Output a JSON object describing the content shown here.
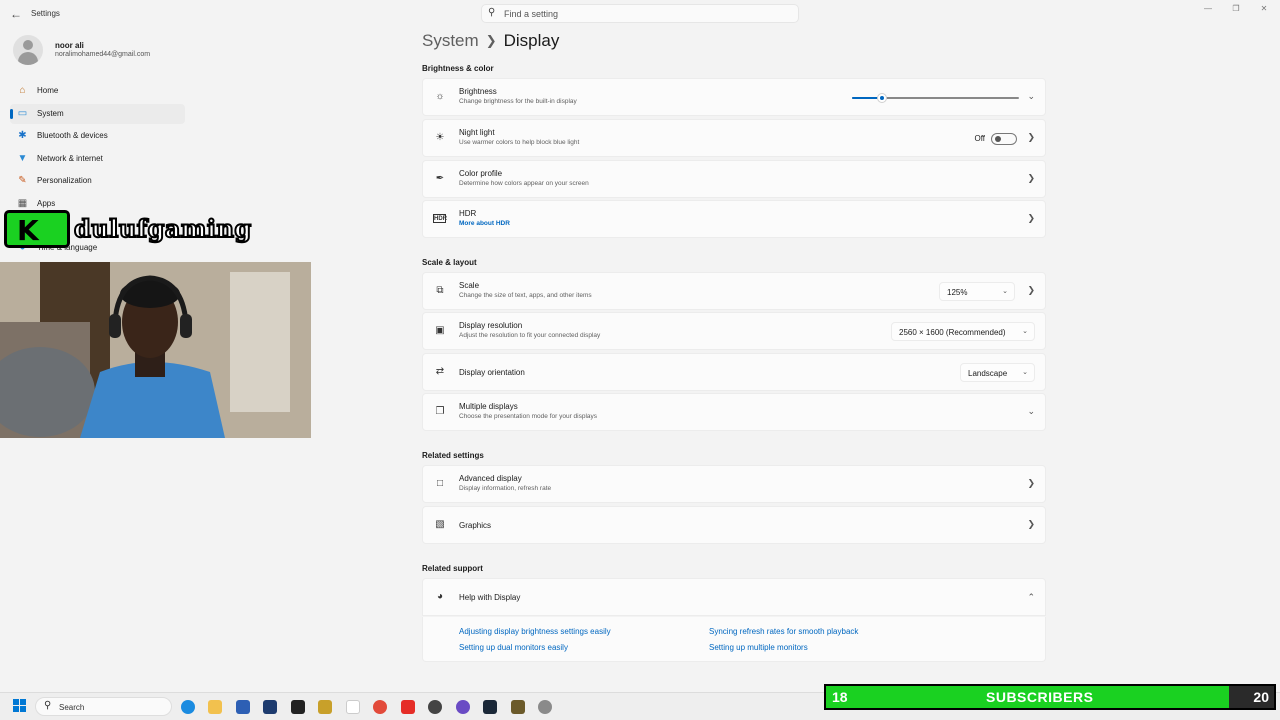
{
  "window": {
    "app_title": "Settings",
    "search_placeholder": "Find a setting"
  },
  "profile": {
    "name": "noor ali",
    "email": "noralimohamed44@gmail.com"
  },
  "sidebar": {
    "items": [
      {
        "label": "Home",
        "icon": "home-icon"
      },
      {
        "label": "System",
        "icon": "monitor-icon",
        "active": true
      },
      {
        "label": "Bluetooth & devices",
        "icon": "bluetooth-icon"
      },
      {
        "label": "Network & internet",
        "icon": "wifi-icon"
      },
      {
        "label": "Personalization",
        "icon": "brush-icon"
      },
      {
        "label": "Apps",
        "icon": "apps-icon"
      },
      {
        "label": "Time & language",
        "icon": "globe-icon"
      }
    ]
  },
  "overlay": {
    "brand": "dulufgaming",
    "logo_letter": "K"
  },
  "breadcrumb": {
    "parent": "System",
    "current": "Display"
  },
  "sections": {
    "brightness_color": "Brightness & color",
    "scale_layout": "Scale & layout",
    "related_settings": "Related settings",
    "related_support": "Related support"
  },
  "brightness": {
    "title": "Brightness",
    "subtitle": "Change brightness for the built-in display",
    "level": 0.18
  },
  "night_light": {
    "title": "Night light",
    "subtitle": "Use warmer colors to help block blue light",
    "state": "Off"
  },
  "color_profile": {
    "title": "Color profile",
    "subtitle": "Determine how colors appear on your screen"
  },
  "hdr": {
    "title": "HDR",
    "link": "More about HDR"
  },
  "scale": {
    "title": "Scale",
    "subtitle": "Change the size of text, apps, and other items",
    "value": "125%"
  },
  "resolution": {
    "title": "Display resolution",
    "subtitle": "Adjust the resolution to fit your connected display",
    "value": "2560 × 1600 (Recommended)"
  },
  "orientation": {
    "title": "Display orientation",
    "value": "Landscape"
  },
  "multiple": {
    "title": "Multiple displays",
    "subtitle": "Choose the presentation mode for your displays"
  },
  "advanced": {
    "title": "Advanced display",
    "subtitle": "Display information, refresh rate"
  },
  "graphics": {
    "title": "Graphics"
  },
  "help": {
    "title": "Help with Display",
    "links": [
      "Adjusting display brightness settings easily",
      "Syncing refresh rates for smooth playback",
      "Setting up dual monitors easily",
      "Setting up multiple monitors"
    ]
  },
  "taskbar": {
    "search_label": "Search"
  },
  "subscribers": {
    "current": "18",
    "label": "SUBSCRIBERS",
    "goal": "20",
    "progress": 0.9
  },
  "colors": {
    "accent": "#0067c0",
    "overlay_green": "#1ad121"
  }
}
